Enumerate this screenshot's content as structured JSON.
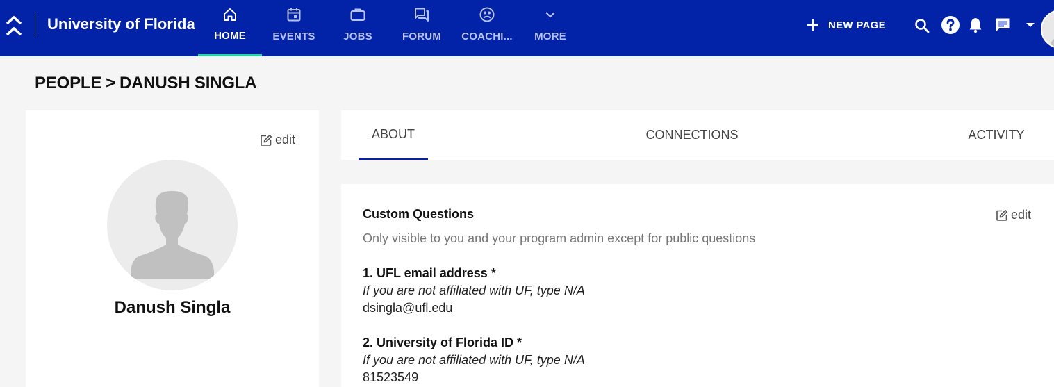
{
  "header": {
    "brand": "University of Florida",
    "nav": [
      {
        "label": "HOME",
        "icon": "home-icon"
      },
      {
        "label": "EVENTS",
        "icon": "calendar-icon"
      },
      {
        "label": "JOBS",
        "icon": "briefcase-icon"
      },
      {
        "label": "FORUM",
        "icon": "forum-icon"
      },
      {
        "label": "COACHI...",
        "icon": "coaching-icon"
      },
      {
        "label": "MORE",
        "icon": "chevron-down-icon"
      }
    ],
    "new_page_label": "NEW PAGE",
    "colors": {
      "bar": "#0222a8",
      "active_indicator": "#28d3a2"
    }
  },
  "breadcrumb": {
    "section": "PEOPLE",
    "separator": ">",
    "current": "DANUSH SINGLA"
  },
  "profile": {
    "edit_label": "edit",
    "name": "Danush Singla"
  },
  "tabs": [
    {
      "label": "ABOUT",
      "active": true
    },
    {
      "label": "CONNECTIONS",
      "active": false
    },
    {
      "label": "ACTIVITY",
      "active": false
    }
  ],
  "about": {
    "title": "Custom Questions",
    "edit_label": "edit",
    "subtitle": "Only visible to you and your program admin except for public questions",
    "questions": [
      {
        "title": "1. UFL email address *",
        "hint": "If you are not affiliated with UF, type N/A",
        "answer": "dsingla@ufl.edu"
      },
      {
        "title": "2. University of Florida ID *",
        "hint": "If you are not affiliated with UF, type N/A",
        "answer": "81523549"
      }
    ]
  }
}
